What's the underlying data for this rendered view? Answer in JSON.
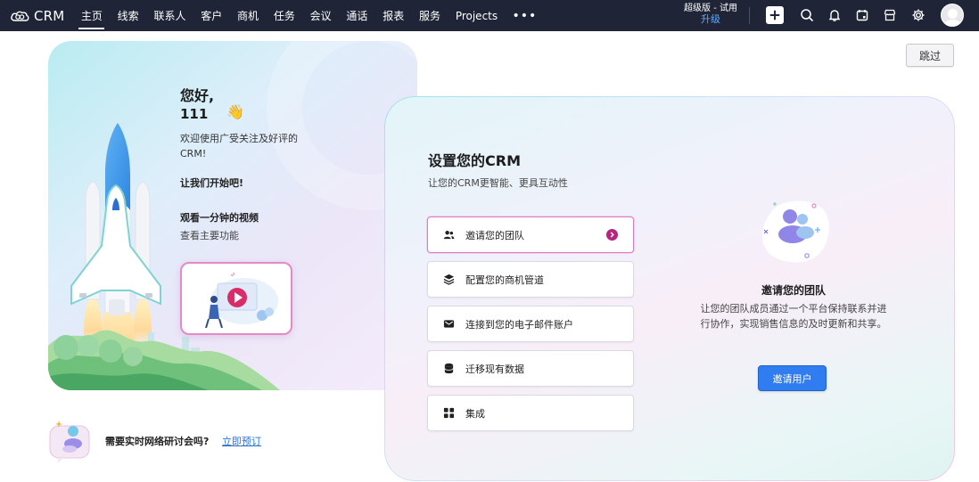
{
  "topbar": {
    "logo_text": "CRM",
    "nav_items": [
      "主页",
      "线索",
      "联系人",
      "客户",
      "商机",
      "任务",
      "会议",
      "通话",
      "报表",
      "服务",
      "Projects"
    ],
    "more_label": "•••",
    "edition_name": "超级版 - 试用",
    "upgrade_label": "升级",
    "icons": [
      "plus-icon",
      "search-icon",
      "bell-icon",
      "calendar-icon",
      "store-icon",
      "gear-icon",
      "avatar"
    ]
  },
  "skip_label": "跳过",
  "hero": {
    "greeting": "您好,",
    "user_name": "111",
    "wave": "👋",
    "welcome": "欢迎使用广受关注及好评的CRM!",
    "start": "让我们开始吧!",
    "video_title": "观看一分钟的视频",
    "video_subtitle": "查看主要功能"
  },
  "webinar": {
    "question": "需要实时网络研讨会吗?",
    "link": "立即预订"
  },
  "setup": {
    "title": "设置您的CRM",
    "subtitle": "让您的CRM更智能、更具互动性",
    "steps": [
      {
        "label": "邀请您的团队",
        "icon": "users-icon",
        "active": true
      },
      {
        "label": "配置您的商机管道",
        "icon": "layers-icon",
        "active": false
      },
      {
        "label": "连接到您的电子邮件账户",
        "icon": "mail-icon",
        "active": false
      },
      {
        "label": "迁移现有数据",
        "icon": "database-icon",
        "active": false
      },
      {
        "label": "集成",
        "icon": "grid-icon",
        "active": false
      }
    ],
    "detail": {
      "title": "邀请您的团队",
      "description": "让您的团队成员通过一个平台保持联系并进行协作，实现销售信息的及时更新和共享。",
      "button": "邀请用户"
    }
  },
  "colors": {
    "topbar": "#1f2537",
    "accent_pink": "#b5257e",
    "primary_blue": "#2f7df0",
    "link_blue": "#2c73d2"
  }
}
